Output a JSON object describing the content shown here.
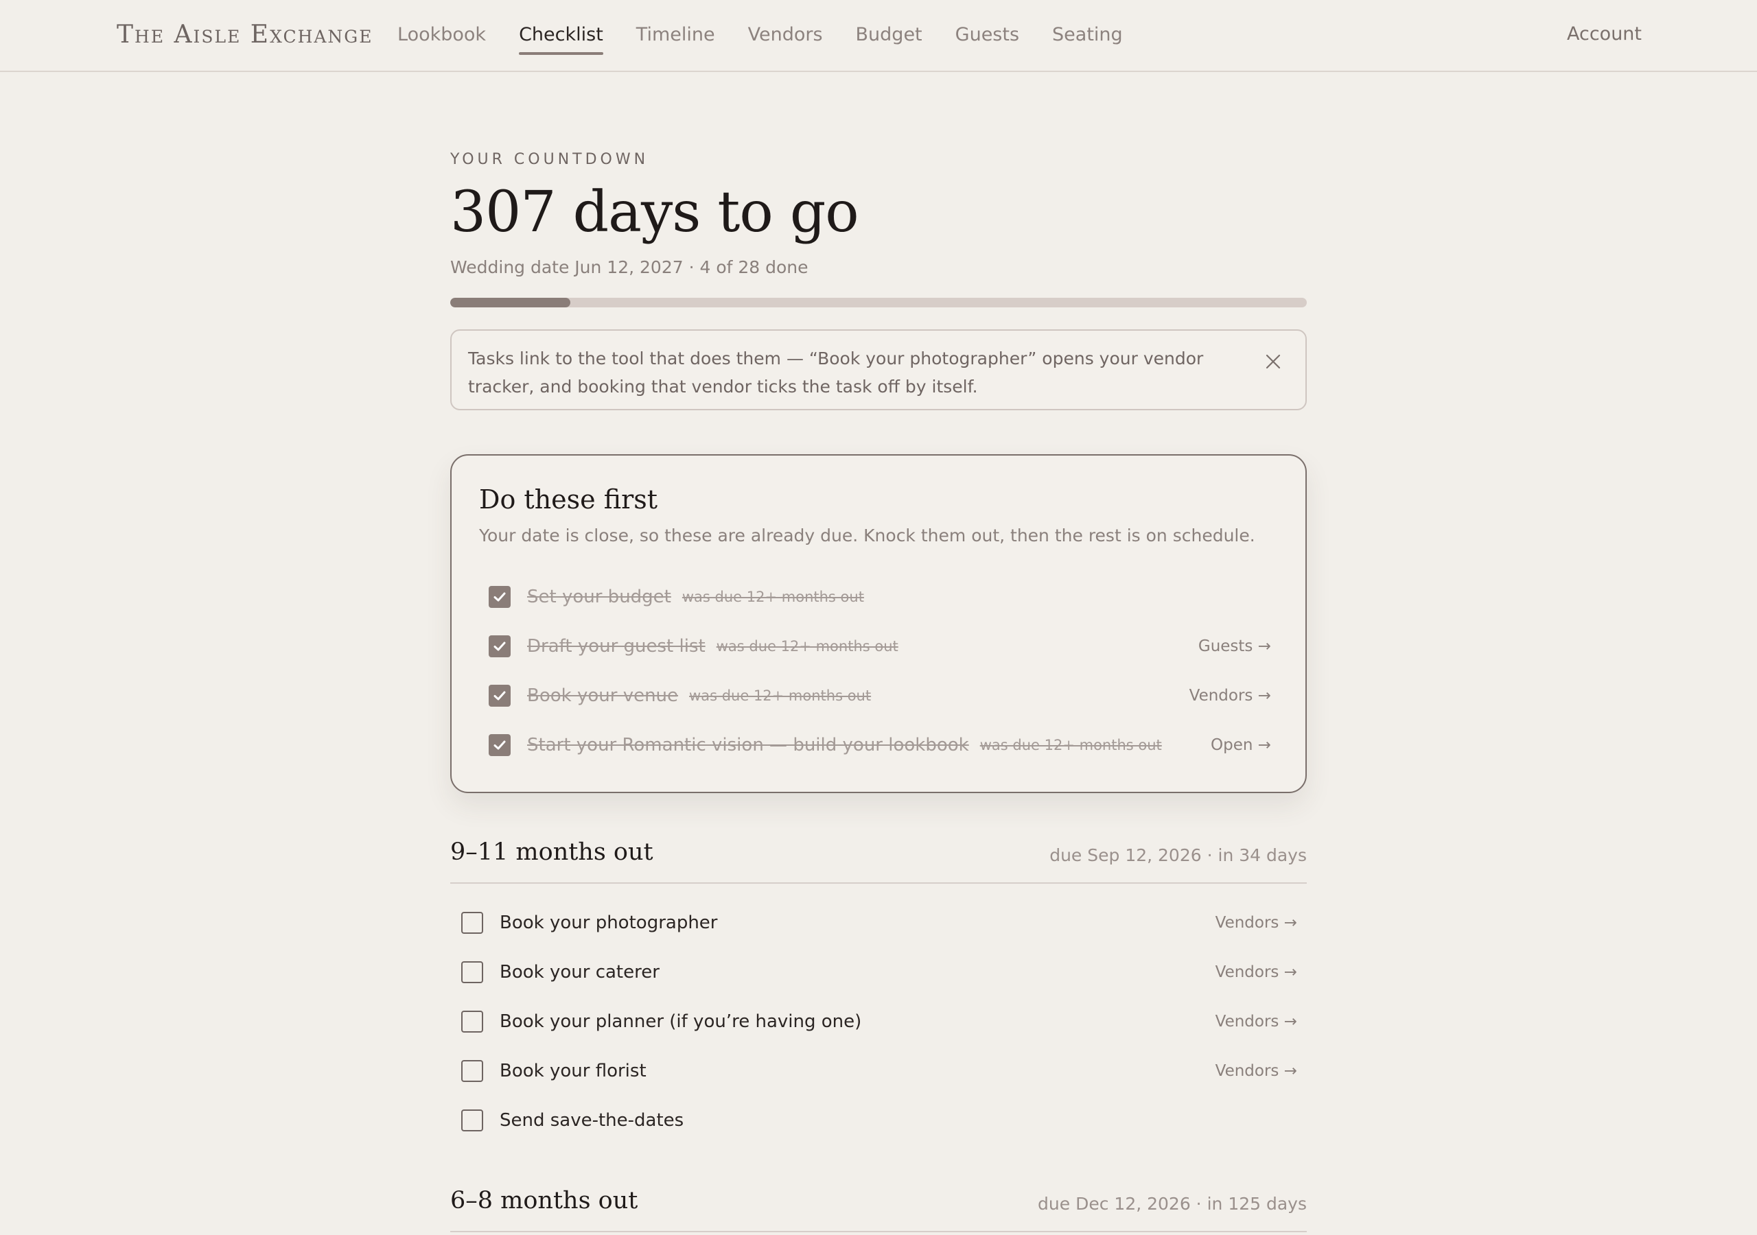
{
  "nav": {
    "brand": "The Aisle Exchange",
    "links": [
      "Lookbook",
      "Checklist",
      "Timeline",
      "Vendors",
      "Budget",
      "Guests",
      "Seating"
    ],
    "active": "Checklist",
    "account": "Account"
  },
  "countdown": {
    "eyebrow": "YOUR COUNTDOWN",
    "headline": "307 days to go",
    "subline": "Wedding date Jun 12, 2027 · 4 of 28 done",
    "progress_fraction": 0.14
  },
  "notice": {
    "text": "Tasks link to the tool that does them — “Book your photographer” opens your vendor tracker, and booking that vendor ticks the task off by itself."
  },
  "first": {
    "title": "Do these first",
    "desc": "Your date is close, so these are already due. Knock them out, then the rest is on schedule.",
    "items": [
      {
        "label": "Set your budget",
        "note": "was due 12+ months out",
        "link": ""
      },
      {
        "label": "Draft your guest list",
        "note": "was due 12+ months out",
        "link": "Guests →"
      },
      {
        "label": "Book your venue",
        "note": "was due 12+ months out",
        "link": "Vendors →"
      },
      {
        "label": "Start your Romantic vision — build your lookbook",
        "note": "was due 12+ months out",
        "link": "Open →"
      }
    ]
  },
  "sections": [
    {
      "title": "9–11 months out",
      "due": "due Sep 12, 2026 · in 34 days",
      "items": [
        {
          "label": "Book your photographer",
          "link": "Vendors →"
        },
        {
          "label": "Book your caterer",
          "link": "Vendors →"
        },
        {
          "label": "Book your planner (if you’re having one)",
          "link": "Vendors →"
        },
        {
          "label": "Book your florist",
          "link": "Vendors →"
        },
        {
          "label": "Send save-the-dates",
          "link": ""
        }
      ]
    },
    {
      "title": "6–8 months out",
      "due": "due Dec 12, 2026 · in 125 days",
      "items": []
    }
  ],
  "colors": {
    "background": "#f2efea",
    "accent": "#8a7d78",
    "progress_track": "#d7cdc8",
    "text_dark": "#1f1a19",
    "text_muted": "#8a807c"
  },
  "icons": {
    "notice_close": "close-icon",
    "check": "checkmark-icon"
  }
}
